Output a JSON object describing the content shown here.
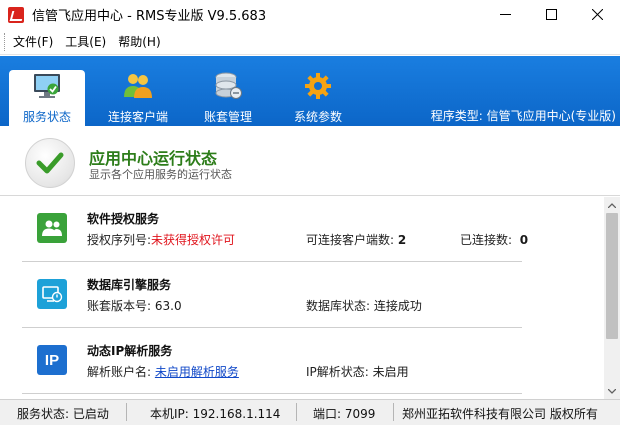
{
  "window": {
    "title": "信管飞应用中心 - RMS专业版 V9.5.683"
  },
  "menu": [
    {
      "label": "文件(F)"
    },
    {
      "label": "工具(E)"
    },
    {
      "label": "帮助(H)"
    }
  ],
  "tabs": [
    {
      "label": "服务状态",
      "icon": "monitor-check-icon",
      "active": true
    },
    {
      "label": "连接客户端",
      "icon": "users-icon",
      "active": false
    },
    {
      "label": "账套管理",
      "icon": "database-icon",
      "active": false
    },
    {
      "label": "系统参数",
      "icon": "gear-icon",
      "active": false
    }
  ],
  "program_type": "程序类型: 信管飞应用中心(专业版)",
  "header": {
    "title": "应用中心运行状态",
    "subtitle": "显示各个应用服务的运行状态"
  },
  "services": [
    {
      "name": "软件授权服务",
      "icon": "users-icon",
      "row": [
        {
          "label": "授权序列号:",
          "value": "未获得授权许可",
          "style": "red"
        },
        {
          "label": "可连接客户端数:",
          "value": "2",
          "style": "bold"
        },
        {
          "label": "已连接数:",
          "value": "0",
          "style": "bold"
        }
      ]
    },
    {
      "name": "数据库引擎服务",
      "icon": "database-engine-icon",
      "row": [
        {
          "label": "账套版本号:",
          "value": "63.0",
          "style": ""
        },
        {
          "label": "数据库状态:",
          "value": "连接成功",
          "style": ""
        }
      ]
    },
    {
      "name": "动态IP解析服务",
      "icon": "ip-icon",
      "icon_text": "IP",
      "row": [
        {
          "label": "解析账户名:",
          "value": "未启用解析服务",
          "style": "link"
        },
        {
          "label": "IP解析状态:",
          "value": "未启用",
          "style": ""
        }
      ]
    }
  ],
  "status_bar": {
    "service_status": "服务状态: 已启动",
    "local_ip": "本机IP: 192.168.1.114",
    "port": "端口: 7099",
    "company": "郑州亚拓软件科技有限公司  版权所有"
  },
  "colors": {
    "toolbar_blue": "#0c66c8",
    "header_green": "#2d7d1a",
    "warning_red": "#e0141c",
    "link_blue": "#1048c8"
  }
}
